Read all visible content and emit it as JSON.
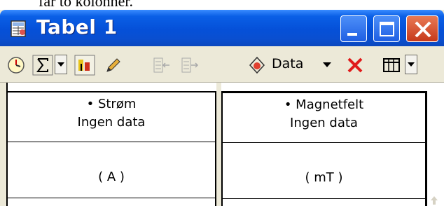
{
  "page_fragment": {
    "text": "far to kolonner."
  },
  "window": {
    "title": "Tabel 1",
    "buttons": {
      "minimize": "minimize",
      "maximize": "maximize",
      "close": "close"
    }
  },
  "toolbar": {
    "data_label": "Data",
    "icons": [
      "timer-icon",
      "sum-icon",
      "dropdown-arrow",
      "column-options-icon",
      "pencil-icon",
      "insert-left-icon",
      "insert-right-icon",
      "data-drop-icon",
      "delete-icon",
      "table-layout-icon",
      "dropdown-arrow"
    ]
  },
  "table": {
    "columns": [
      {
        "name": "Strøm",
        "status": "Ingen data",
        "unit": "( A )"
      },
      {
        "name": "Magnetfelt",
        "status": "Ingen data",
        "unit": "( mT )"
      }
    ]
  }
}
